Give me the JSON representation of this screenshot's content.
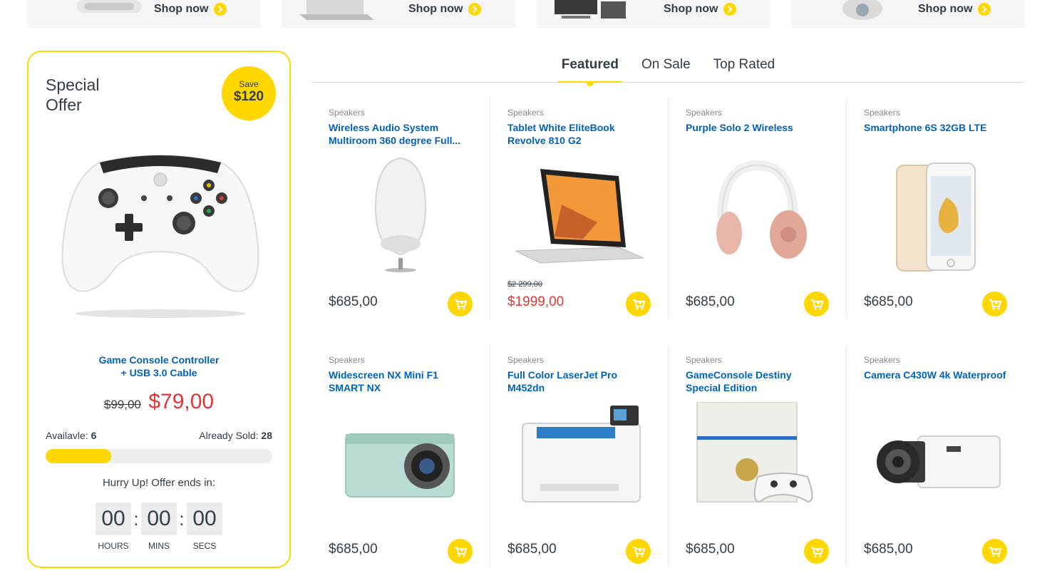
{
  "banners": [
    {
      "label": "Shop now"
    },
    {
      "label": "Shop now"
    },
    {
      "label": "Shop now"
    },
    {
      "label": "Shop now"
    }
  ],
  "special_offer": {
    "title": "Special Offer",
    "save_label": "Save",
    "save_amount": "$120",
    "product_name_line1": "Game Console Controller",
    "product_name_line2": "+ USB 3.0 Cable",
    "old_price": "$99,00",
    "new_price": "$79,00",
    "available_label": "Availavle:",
    "available_value": "6",
    "sold_label": "Already Sold:",
    "sold_value": "28",
    "sold_fraction": 0.29,
    "hurry_text": "Hurry Up! Offer ends in:",
    "countdown": {
      "hours": "00",
      "mins": "00",
      "secs": "00",
      "hours_label": "HOURS",
      "mins_label": "MINS",
      "secs_label": "SECS"
    }
  },
  "tabs": [
    {
      "label": "Featured",
      "active": true
    },
    {
      "label": "On Sale",
      "active": false
    },
    {
      "label": "Top Rated",
      "active": false
    }
  ],
  "products": [
    {
      "category": "Speakers",
      "name": "Wireless Audio System Multiroom 360 degree Full...",
      "price": "$685,00",
      "old_price": "",
      "icon": "speaker"
    },
    {
      "category": "Speakers",
      "name": "Tablet White EliteBook Revolve 810 G2",
      "price": "$1999,00",
      "old_price": "$2 299,00",
      "icon": "laptop"
    },
    {
      "category": "Speakers",
      "name": "Purple Solo 2 Wireless",
      "price": "$685,00",
      "old_price": "",
      "icon": "headphones"
    },
    {
      "category": "Speakers",
      "name": "Smartphone 6S 32GB LTE",
      "price": "$685,00",
      "old_price": "",
      "icon": "smartphone"
    },
    {
      "category": "Speakers",
      "name": "Widescreen NX Mini F1 SMART NX",
      "price": "$685,00",
      "old_price": "",
      "icon": "camera"
    },
    {
      "category": "Speakers",
      "name": "Full Color LaserJet Pro M452dn",
      "price": "$685,00",
      "old_price": "",
      "icon": "printer"
    },
    {
      "category": "Speakers",
      "name": "GameConsole Destiny Special Edition",
      "price": "$685,00",
      "old_price": "",
      "icon": "game-console"
    },
    {
      "category": "Speakers",
      "name": "Camera C430W 4k Waterproof",
      "price": "$685,00",
      "old_price": "",
      "icon": "camcorder"
    }
  ],
  "colors": {
    "accent": "#fed700",
    "link": "#0062bd",
    "sale": "#df3737",
    "text": "#333e48"
  }
}
